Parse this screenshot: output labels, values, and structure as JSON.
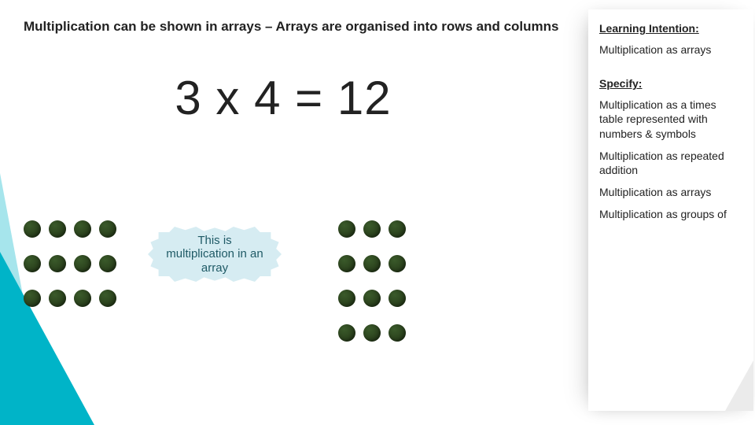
{
  "header": "Multiplication can be shown in arrays – Arrays are organised into rows and columns",
  "equation": "3 x 4 = 12",
  "callout": "This is multiplication in an array",
  "arrays": {
    "left": {
      "rows": 3,
      "cols": 4
    },
    "right": {
      "rows": 4,
      "cols": 3
    }
  },
  "sidebar": {
    "li_title": "Learning Intention:",
    "li_item": "Multiplication as arrays",
    "spec_title": "Specify:",
    "spec_items": [
      "Multiplication as a times table represented with numbers & symbols",
      "Multiplication as repeated addition",
      "Multiplication as arrays",
      "Multiplication as groups of"
    ]
  },
  "colors": {
    "accent": "#00b4c8",
    "dot": "#2b421d",
    "callout_bg": "#d6ecf2"
  }
}
